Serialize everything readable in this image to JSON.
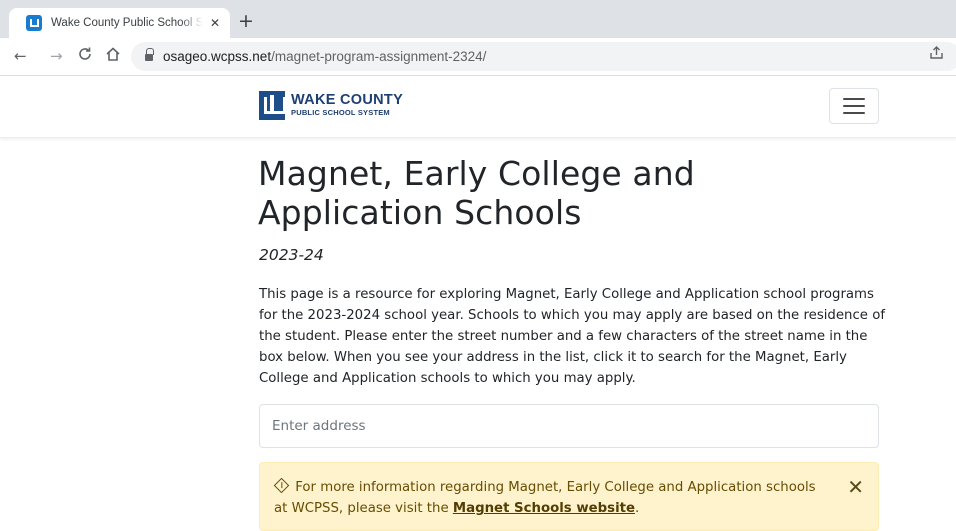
{
  "browser": {
    "tab_title": "Wake County Public School System",
    "tab_close": "✕",
    "new_tab": "+",
    "nav": {
      "back": "←",
      "forward": "→",
      "reload": "C",
      "home": "⌂"
    },
    "url_host": "osageo.wcpss.net",
    "url_path": "/magnet-program-assignment-2324/"
  },
  "header": {
    "logo_line1": "WAKE COUNTY",
    "logo_line2": "PUBLIC SCHOOL SYSTEM"
  },
  "main": {
    "title": "Magnet, Early College and Application Schools",
    "subtitle": "2023-24",
    "intro": "This page is a resource for exploring Magnet, Early College and Application school programs for the 2023-2024 school year. Schools to which you may apply are based on the residence of the student. Please enter the street number and a few characters of the street name in the box below. When you see your address in the list, click it to search for the Magnet, Early College and Application schools to which you may apply.",
    "address_placeholder": "Enter address",
    "address_value": ""
  },
  "alert": {
    "text_before": "For more information regarding Magnet, Early College and Application schools at WCPSS, please visit the ",
    "link_text": "Magnet Schools website",
    "text_after": ".",
    "close": "✕",
    "colors": {
      "background": "#fff3cd",
      "text": "#664d03"
    }
  },
  "colors": {
    "brand": "#1d4e89"
  }
}
